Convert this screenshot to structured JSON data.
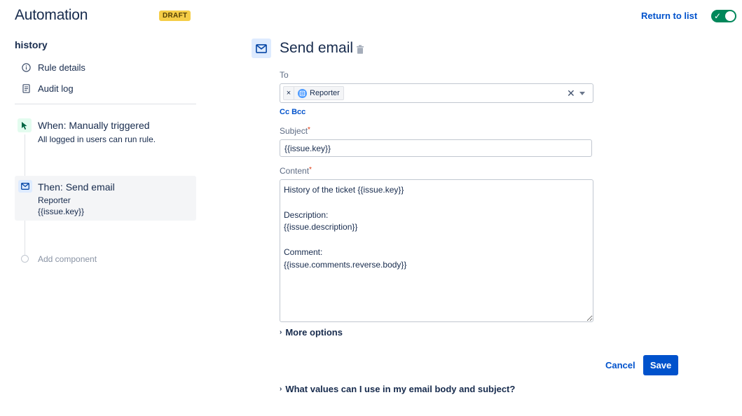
{
  "header": {
    "app_title": "Automation",
    "status_badge": "DRAFT",
    "return_link": "Return to list",
    "rule_enabled": true,
    "accent_color": "#0052cc",
    "toggle_color": "#00875a"
  },
  "sidebar": {
    "rule_name": "history",
    "nav_items": [
      {
        "label": "Rule details",
        "icon": "info-icon"
      },
      {
        "label": "Audit log",
        "icon": "document-icon"
      }
    ],
    "trigger": {
      "title": "When: Manually triggered",
      "subtitle": "All logged in users can run rule.",
      "icon": "cursor-icon"
    },
    "action": {
      "title": "Then: Send email",
      "line1": "Reporter",
      "line2": "{{issue.key}}",
      "icon": "mail-icon"
    },
    "add_component": "Add component"
  },
  "main": {
    "title": "Send email",
    "to_label": "To",
    "to_recipients": [
      "Reporter"
    ],
    "cc_bcc": "Cc Bcc",
    "subject_label": "Subject",
    "subject_value": "{{issue.key}}",
    "content_label": "Content",
    "content_value": "History of the ticket {{issue.key}}\n\nDescription:\n{{issue.description}}\n\nComment:\n{{issue.comments.reverse.body}}",
    "more_options": "More options",
    "cancel_label": "Cancel",
    "save_label": "Save",
    "help_expander": "What values can I use in my email body and subject?"
  }
}
